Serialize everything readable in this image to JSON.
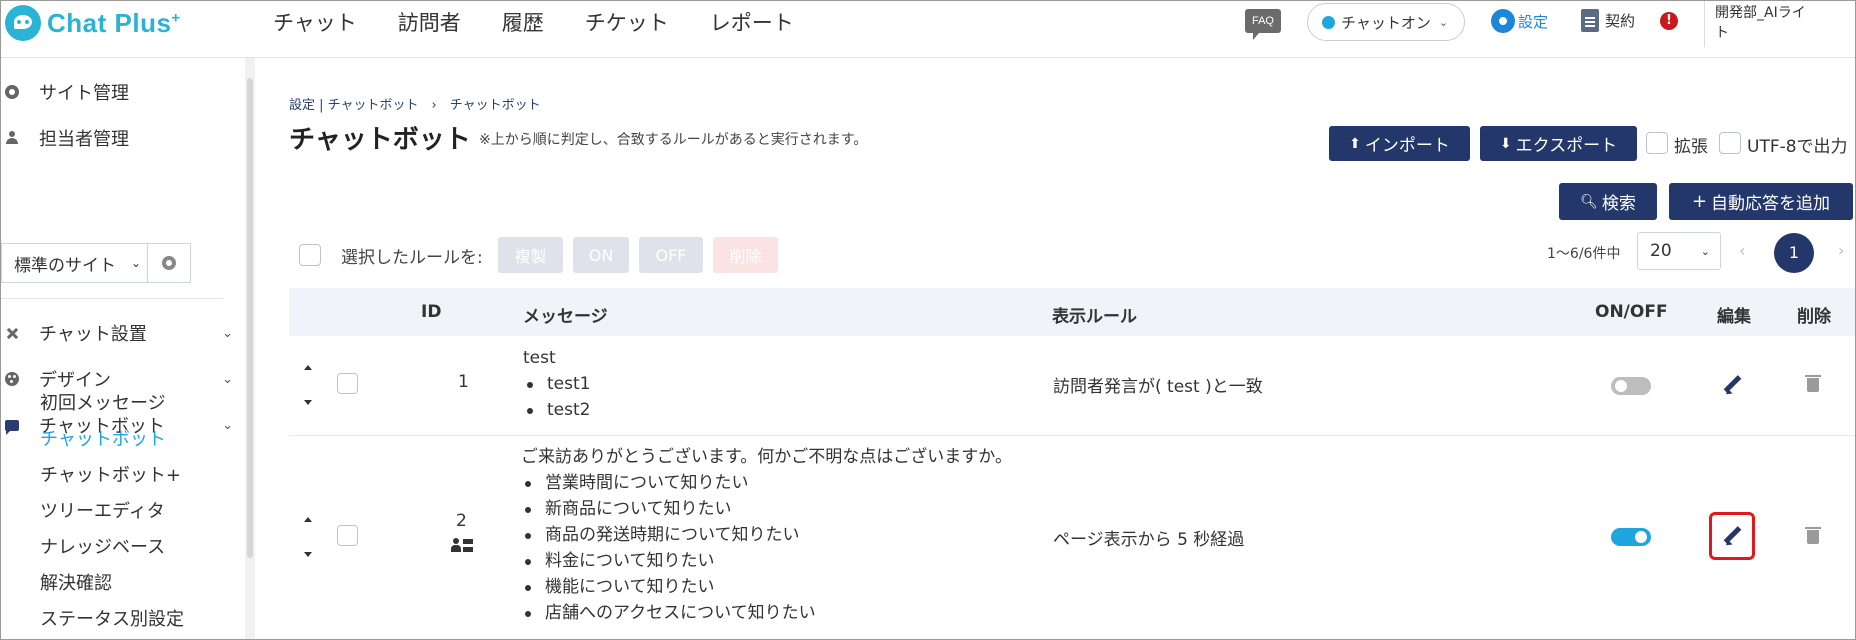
{
  "app": {
    "logo_text": "Chat Plus",
    "logo_sup": "+"
  },
  "topnav": {
    "items": [
      "チャット",
      "訪問者",
      "履歴",
      "チケット",
      "レポート"
    ],
    "faq": "FAQ",
    "status": "チャットオン",
    "settings": "設定",
    "contract": "契約",
    "alert": "!",
    "user_line1": "開発部_AIライ",
    "user_line2": "ト"
  },
  "sidebar": {
    "site_manage": "サイト管理",
    "staff_manage": "担当者管理",
    "site_select": "標準のサイト",
    "chat_setup": "チャット設置",
    "design": "デザイン",
    "chatbot": "チャットボット",
    "sub_items": [
      "初回メッセージ",
      "チャットボット",
      "チャットボット+",
      "ツリーエディタ",
      "ナレッジベース",
      "解決確認",
      "ステータス別設定"
    ],
    "active_index": 1
  },
  "main": {
    "breadcrumb": "設定 | チャットボット　›　チャットボット",
    "title": "チャットボット",
    "note": "※上から順に判定し、合致するルールがあると実行されます。",
    "import_label": "インポート",
    "export_label": "エクスポート",
    "expand_label": "拡張",
    "utf8_label": "UTF-8で出力",
    "search_label": "検索",
    "add_label": "自動応答を追加",
    "bulk_label": "選択したルールを:",
    "bulk_copy": "複製",
    "bulk_on": "ON",
    "bulk_off": "OFF",
    "bulk_delete": "削除",
    "count_text": "1～6/6件中",
    "page_size": "20",
    "current_page": "1"
  },
  "table": {
    "headers": {
      "id": "ID",
      "message": "メッセージ",
      "rule": "表示ルール",
      "onoff": "ON/OFF",
      "edit": "編集",
      "delete": "削除"
    },
    "rows": [
      {
        "id": "1",
        "message_head": "test",
        "message_items": [
          "test1",
          "test2"
        ],
        "rule": "訪問者発言が( test )と一致",
        "enabled": false
      },
      {
        "id": "2",
        "message_head": "ご来訪ありがとうございます。何かご不明な点はございますか。",
        "message_items": [
          "営業時間について知りたい",
          "新商品について知りたい",
          "商品の発送時期について知りたい",
          "料金について知りたい",
          "機能について知りたい",
          "店舗へのアクセスについて知りたい"
        ],
        "rule": "ページ表示から 5 秒経過",
        "enabled": true
      }
    ]
  },
  "colors": {
    "accent": "#1fa6e0",
    "navy": "#23376a",
    "highlight": "#e0191f"
  }
}
